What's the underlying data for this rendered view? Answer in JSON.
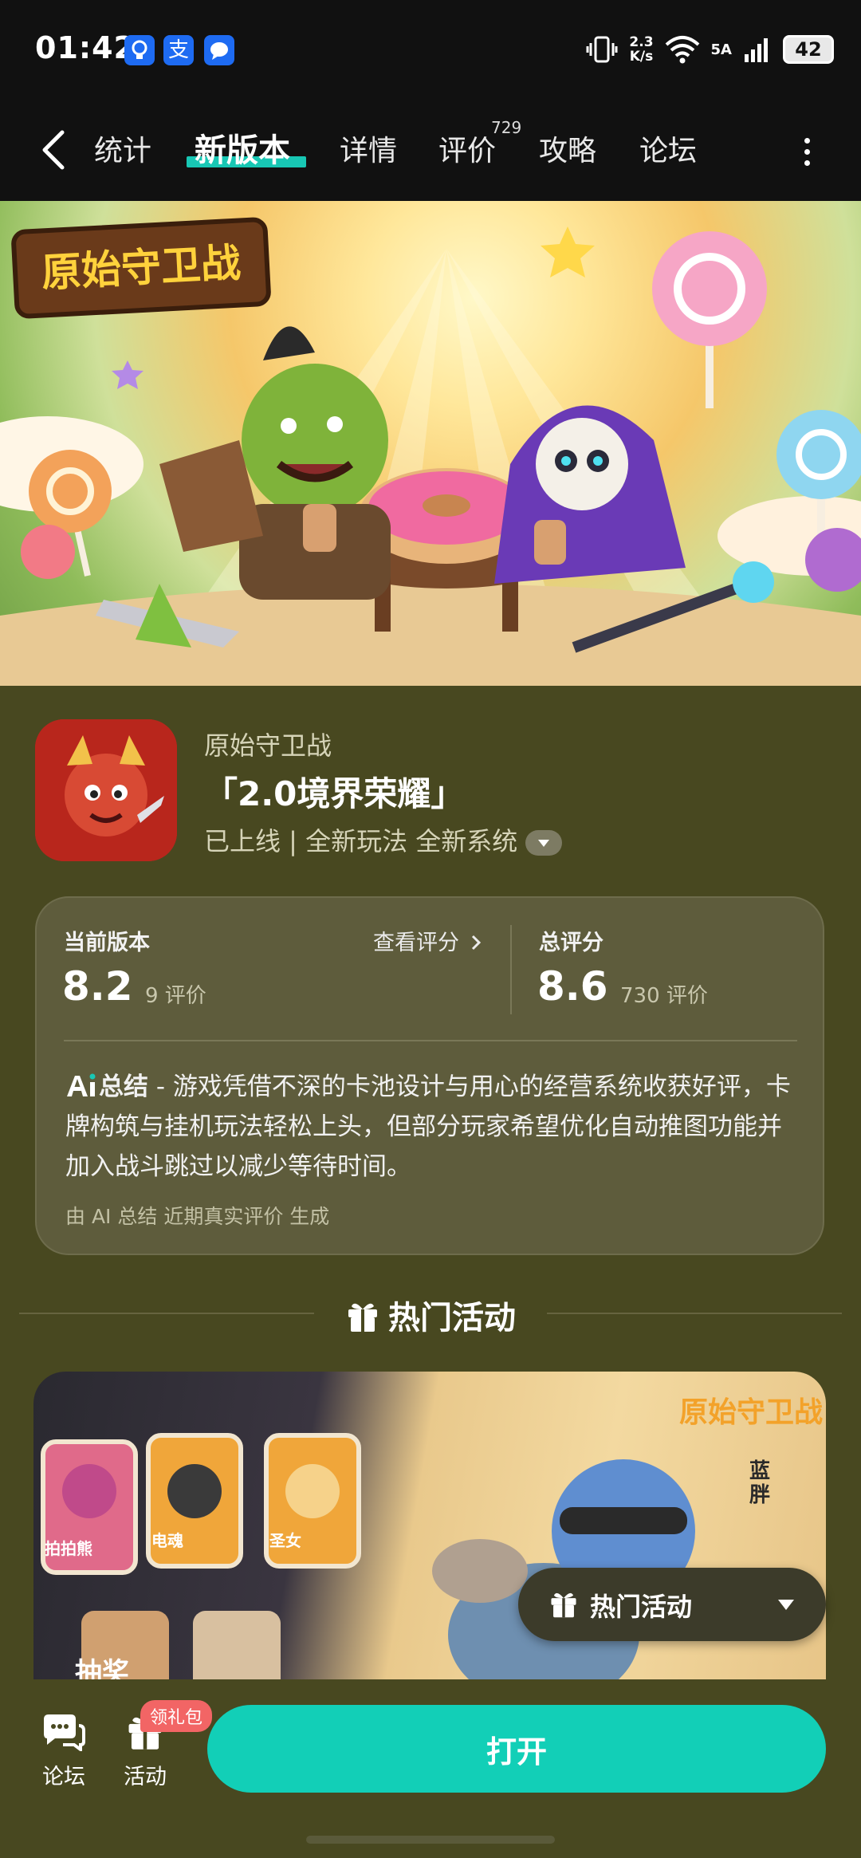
{
  "status_bar": {
    "time": "01:42",
    "app_icons": [
      "lightbulb-icon",
      "alipay-icon",
      "message-icon"
    ],
    "alipay_glyph": "支",
    "net_speed_value": "2.3",
    "net_speed_unit": "K/s",
    "network_type": "5A",
    "battery": "42"
  },
  "tabs": [
    {
      "label": "统计"
    },
    {
      "label": "新版本"
    },
    {
      "label": "详情"
    },
    {
      "label": "评价"
    },
    {
      "label": "攻略"
    },
    {
      "label": "论坛"
    }
  ],
  "active_tab": "新版本",
  "review_count_badge": "729",
  "banner": {
    "logo_text": "原始守卫战"
  },
  "app": {
    "name": "原始守卫战",
    "version_title": "「2.0境界荣耀」",
    "tags": "已上线 | 全新玩法  全新系统"
  },
  "rating": {
    "current_label": "当前版本",
    "view_link": "查看评分",
    "current_score": "8.2",
    "current_count": "9 评价",
    "total_label": "总评分",
    "total_score": "8.6",
    "total_count": "730 评价",
    "ai_label": "总结",
    "ai_summary": " - 游戏凭借不深的卡池设计与用心的经营系统收获好评，卡牌构筑与挂机玩法轻松上头，但部分玩家希望优化自动推图功能并加入战斗跳过以减少等待时间。",
    "ai_footer": "由 AI 总结 近期真实评价 生成"
  },
  "section": {
    "title": "热门活动"
  },
  "activity": {
    "logo_text": "原始守卫战",
    "side_text": "蓝胖",
    "cards": [
      "拍拍熊",
      "电魂",
      "圣女"
    ],
    "bottom_text": "抽奖",
    "floating_label": "热门活动"
  },
  "bottom_bar": {
    "forum_label": "论坛",
    "activity_label": "活动",
    "gift_badge": "领礼包",
    "open_button": "打开"
  },
  "colors": {
    "accent": "#12cfb7",
    "page_bg": "#484820",
    "card_bg": "#5e5c3c",
    "badge_red": "#f26565"
  }
}
